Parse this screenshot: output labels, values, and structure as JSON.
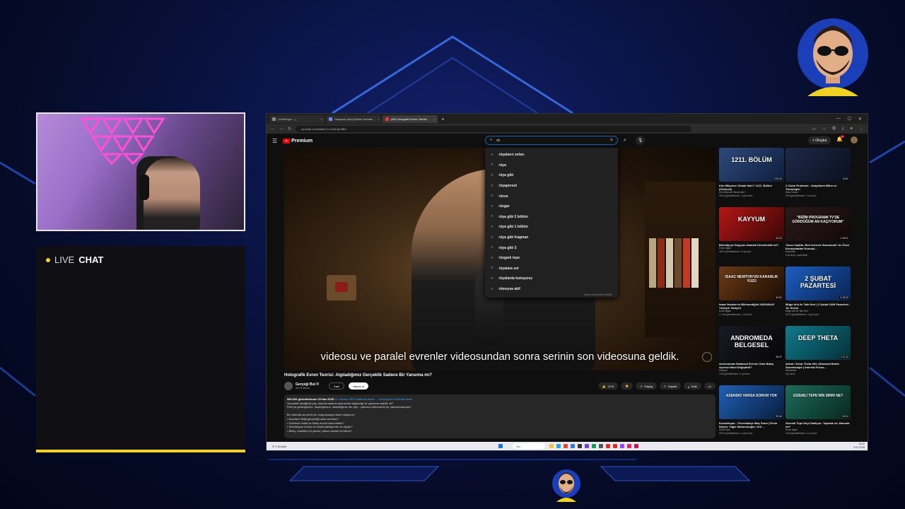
{
  "chat": {
    "live": "LIVE",
    "chat": "CHAT"
  },
  "browser": {
    "tabs": [
      "(Yükleniyor ...)",
      "Hesaplar (Ana) Bölüm Derinlik ...",
      "(89) Holografik Evren Teorisi ..."
    ],
    "new_tab": "+",
    "url": "youtube.com/watch?v=CsdCqb2BM"
  },
  "youtube": {
    "brand": "Premium",
    "search_query": "rü",
    "create_label": "+ Oluştur",
    "bell_badge": "9+",
    "suggestions": [
      "rüyaların sırları",
      "rüya",
      "rüya gibi",
      "rüyaperest",
      "rüzva",
      "rüzgar",
      "rüya gibi 2 bölüm",
      "rüya gibi 1 bölüm",
      "rüya gibi fragman",
      "rüya gibi 3",
      "rüzgarlı tepe",
      "rüyalara sor",
      "rüyalarda buluşuruz",
      "rümeysa akif"
    ],
    "report_label": "Arama tahminlerini bildirin",
    "subtitle": "videosu ve paralel evrenler videosundan sonra serinin son videosuna geldik.",
    "video_title": "Holografik Evren Teorisi: Algıladığımız Gerçeklik Sadece Bir Yansıma mı?",
    "channel_name": "Gerçeği Bul ®",
    "channel_subs": "324 B abone",
    "join_label": "Katıl",
    "subscribe_label": "Abone ol",
    "likes": "21 B",
    "share": "Paylaş",
    "save": "Kaydet",
    "download": "İndir",
    "more": "•••",
    "desc_meta": "580.653 görüntülenme  20 Haz 2025",
    "desc_tag": "#1 Haziran 2025 tarihinde dışarı ... Gerçeği Bul Podcast Serisi",
    "desc_lines": [
      "Gerçeklik dediğimiz şey, aslında sadece beynimizin algıladığı bir yansıma olabilir mi?",
      "Peki ya gördüğümüz, duyduğumuz, hissettiğimiz her şey... yalnızca bilincimizin bir yanılsamasıysa?",
      "",
      "Bu videoda sizi derin bir sorgulamaya davet ediyorum:",
      "• Kuantum fiziği gerçekliği nasıl tanımlar?",
      "• Gözlemci etkisi ve bilinç evreni nasıl etkiler?",
      "• Simülasyon teorisi ve felsefi yaklaşımlar ne söyler?",
      "• Bilinç, maddeyi mi yaratır, yoksa madde mi bilinci?"
    ]
  },
  "recs": [
    {
      "thumb": "1211. BÖLÜM",
      "dur": "2:03:43",
      "title": "Kim Milyoner Olmak İster? 1211. Bölüm (Gelecek)",
      "channel": "Kim Milyoner Olmak İster?",
      "meta": "415 B görüntülenme • 1 gün önce",
      "c1": "#2e4a7a",
      "c2": "#0e1f3e"
    },
    {
      "thumb": "",
      "dur": "14:51",
      "title": "2 Cisim Problemi - Uzaylıların Bilim ve Teknolojisi",
      "channel": "Barış Özcan",
      "meta": "29 B görüntülenme • 1 yıl önce",
      "c1": "#1d2a48",
      "c2": "#0a0f1e"
    },
    {
      "thumb": "KAYYUM",
      "dur": "20:22",
      "title": "Belediyeye Kayyum Atamak Demokratik mi?",
      "channel": "Evrim Ağacı",
      "meta": "418 B görüntülenme • 4 ay önce",
      "c1": "#b31616",
      "c2": "#3a0606"
    },
    {
      "thumb": "\"BİZİM PROGRAMI TV'DE GÖRDÜĞÜM AN KAÇIYORUM\"",
      "dur": "1:26:11",
      "title": "'Acun Uçaktır, Ben Korsviz Sonrasınki' Az Önce Konuşmadan Konuşu...",
      "channel": "Habertürk",
      "meta": "4 yıl önce • yayınlandı",
      "c1": "#2a1a1a",
      "c2": "#120808"
    },
    {
      "thumb": "ISAAC NEWTON'UN KARANLIK YÜZÜ",
      "dur": "34:51",
      "title": "Isaac Newton'ın Bilinmediğini KARANLIK Yüzüyle Tanıyın!",
      "channel": "Evrim Ağacı",
      "meta": "1.1 Mn görüntülenme • 1 yıl önce",
      "c1": "#6b3a14",
      "c2": "#1c0d04"
    },
    {
      "thumb": "2 ŞUBAT PAZARTESİ",
      "dur": "2:15:02",
      "title": "Müge Anlı ile Tatlı Sert | 2 Şubat 2026 Pazartesi - 18. Sezon",
      "channel": "Müge Anlı ile Tatlı Sert",
      "meta": "972 B görüntülenme • 1 gün önce",
      "c1": "#1b5fbf",
      "c2": "#0a2355"
    },
    {
      "thumb": "ANDROMEDA BELGESEL",
      "dur": "49:47",
      "title": "Andromeda Galaksisi Evrene Olan Bakış Açımızı Nasıl Değiştirdi?",
      "channel": "Astropol",
      "meta": "13 B görüntülenme • 1 yıl önce",
      "c1": "#1a1a24",
      "c2": "#050508"
    },
    {
      "thumb": "DEEP THETA",
      "dur": "1:11:11",
      "title": "Astral / Deep Theta 4Hz | Binaural Beats Soundscape | Internal Focus...",
      "channel": "Mindmusic",
      "meta": "5 yıl önce",
      "c1": "#0f7a8a",
      "c2": "#05303a"
    },
    {
      "thumb": "ASENSIO VARSA SORUN YOK",
      "dur": "20:44",
      "title": "Kocaelispor - Fenerbahçe Maç Sonu | Ersin Düzen, Yağız Sabuncuoğlu, Veli ...",
      "channel": "NOW Spor",
      "meta": "678 B görüntülenme • 4 gün önce",
      "c1": "#1f5fb5",
      "c2": "#081e3e"
    },
    {
      "thumb": "GİZEMLİ TEPE'NİN SIRRI NE?",
      "dur": "20:01",
      "title": "Gizemli Tepe Neyi Saklıyor: Tapınak mı, Barınak mı?",
      "channel": "Evrim Ağacı",
      "meta": "3.5 B görüntülenme • 1 yıl önce",
      "c1": "#1d6b5a",
      "c2": "#082820"
    }
  ],
  "taskbar": {
    "weather": "9°C Bulutlu",
    "search": "Ara",
    "time": "19:02",
    "date": "3.02.2026"
  },
  "colors": {
    "accent": "#f2d21e",
    "youtube_red": "#ff0000",
    "search_focus": "#1c62b9"
  }
}
